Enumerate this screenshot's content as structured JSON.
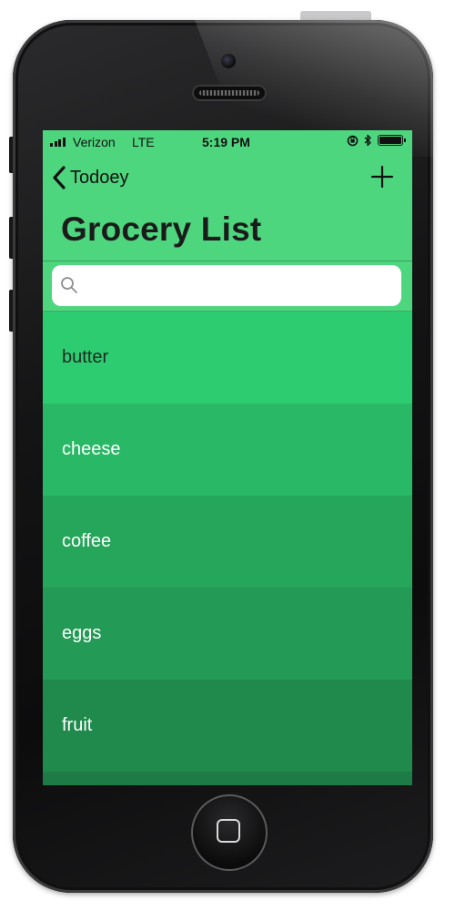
{
  "status_bar": {
    "carrier": "Verizon",
    "network": "LTE",
    "time": "5:19 PM"
  },
  "nav": {
    "back_label": "Todoey",
    "title": "Grocery List"
  },
  "search": {
    "value": "",
    "placeholder": ""
  },
  "items": [
    {
      "label": "butter",
      "bg": "#2ecc71",
      "fg": "#1e2b22"
    },
    {
      "label": "cheese",
      "bg": "#29b866",
      "fg": "#ffffff"
    },
    {
      "label": "coffee",
      "bg": "#25a65b",
      "fg": "#ffffff"
    },
    {
      "label": "eggs",
      "bg": "#239a55",
      "fg": "#ffffff"
    },
    {
      "label": "fruit",
      "bg": "#208a4d",
      "fg": "#ffffff"
    },
    {
      "label": "",
      "bg": "#1d7c45",
      "fg": "#ffffff"
    }
  ],
  "colors": {
    "nav_bar": "#4ed67f",
    "accent": "#2ecc71"
  }
}
